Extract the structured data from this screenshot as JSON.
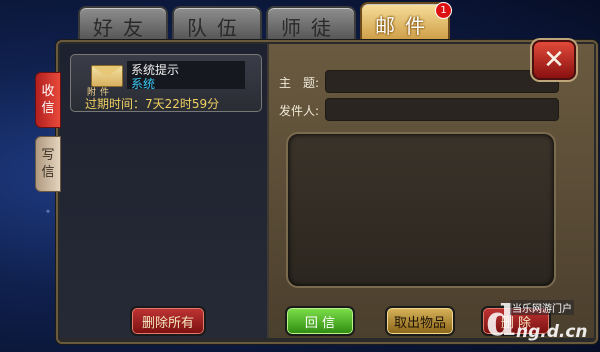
{
  "tabs": [
    {
      "label": "好友"
    },
    {
      "label": "队伍"
    },
    {
      "label": "师徒"
    },
    {
      "label": "邮件",
      "badge": "1"
    }
  ],
  "side_tabs": {
    "receive": "收\n信",
    "write": "写\n信"
  },
  "mail": {
    "attachment_label": "附件",
    "title": "系统提示",
    "sender": "系统",
    "expire": "过期时间：7天22时59分"
  },
  "buttons": {
    "delete_all": "删除所有",
    "reply": "回 信",
    "take_items": "取出物品",
    "delete": "删 除"
  },
  "form": {
    "subject_label": "主　题:",
    "sender_label": "发件人:",
    "subject_value": "",
    "sender_value": "",
    "body_value": ""
  },
  "watermark": {
    "top": "当乐网游门户",
    "logo": "d",
    "url": "ng.d.cn"
  },
  "colors": {
    "active_tab": "#e8c46a",
    "sender": "#38c6f0",
    "expire": "#f0d060"
  }
}
